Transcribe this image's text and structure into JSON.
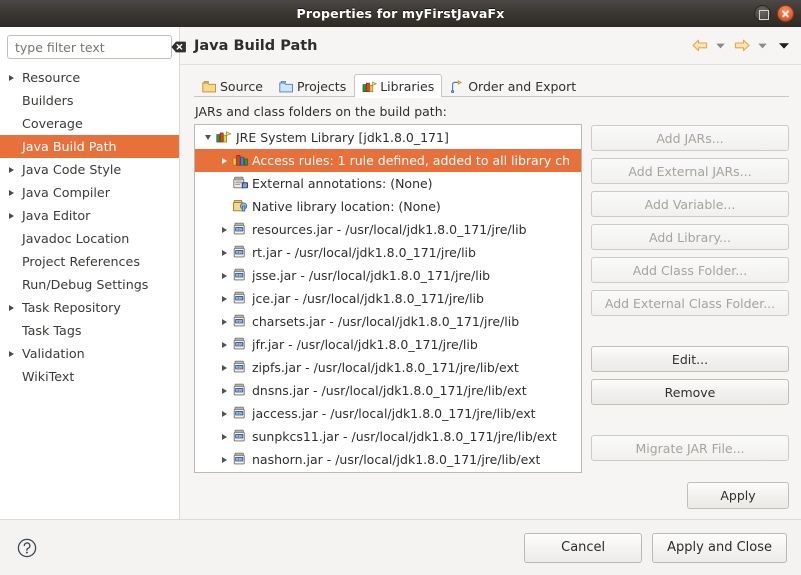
{
  "window": {
    "title": "Properties for myFirstJavaFx",
    "controls": [
      {
        "name": "maximize",
        "label": "Maximize"
      },
      {
        "name": "close",
        "label": "Close"
      }
    ]
  },
  "sidebar": {
    "filter": {
      "placeholder": "type filter text",
      "value": "",
      "clear_icon": "clear-backspace-icon"
    },
    "items": [
      {
        "label": "Resource",
        "expandable": true,
        "selected": false
      },
      {
        "label": "Builders",
        "expandable": false,
        "selected": false
      },
      {
        "label": "Coverage",
        "expandable": false,
        "selected": false
      },
      {
        "label": "Java Build Path",
        "expandable": false,
        "selected": true
      },
      {
        "label": "Java Code Style",
        "expandable": true,
        "selected": false
      },
      {
        "label": "Java Compiler",
        "expandable": true,
        "selected": false
      },
      {
        "label": "Java Editor",
        "expandable": true,
        "selected": false
      },
      {
        "label": "Javadoc Location",
        "expandable": false,
        "selected": false
      },
      {
        "label": "Project References",
        "expandable": false,
        "selected": false
      },
      {
        "label": "Run/Debug Settings",
        "expandable": false,
        "selected": false
      },
      {
        "label": "Task Repository",
        "expandable": true,
        "selected": false
      },
      {
        "label": "Task Tags",
        "expandable": false,
        "selected": false
      },
      {
        "label": "Validation",
        "expandable": true,
        "selected": false
      },
      {
        "label": "WikiText",
        "expandable": false,
        "selected": false
      }
    ]
  },
  "header": {
    "title": "Java Build Path",
    "nav": [
      {
        "name": "back-arrow-icon",
        "label": "Back"
      },
      {
        "name": "back-dropdown-icon",
        "label": "Back history"
      },
      {
        "name": "forward-arrow-icon",
        "label": "Forward"
      },
      {
        "name": "forward-dropdown-icon",
        "label": "Forward history"
      },
      {
        "name": "view-menu-icon",
        "label": "View menu"
      }
    ]
  },
  "tabs": [
    {
      "label": "Source",
      "icon": "source-folder-icon",
      "active": false
    },
    {
      "label": "Projects",
      "icon": "projects-folder-icon",
      "active": false
    },
    {
      "label": "Libraries",
      "icon": "libraries-icon",
      "active": true
    },
    {
      "label": "Order and Export",
      "icon": "order-export-icon",
      "active": false
    }
  ],
  "main": {
    "list_label": "JARs and class folders on the build path:",
    "tree": [
      {
        "label": "JRE System Library [jdk1.8.0_171]",
        "icon": "jre-library-icon",
        "indent": 0,
        "twisty": "open",
        "selected": false
      },
      {
        "label": "Access rules: 1 rule defined, added to all library ch",
        "icon": "access-rules-icon",
        "indent": 1,
        "twisty": "closed",
        "selected": true
      },
      {
        "label": "External annotations: (None)",
        "icon": "annotations-jar-icon",
        "indent": 1,
        "twisty": "none",
        "selected": false
      },
      {
        "label": "Native library location: (None)",
        "icon": "native-library-icon",
        "indent": 1,
        "twisty": "none",
        "selected": false
      },
      {
        "label": "resources.jar - /usr/local/jdk1.8.0_171/jre/lib",
        "icon": "jar-icon",
        "indent": 1,
        "twisty": "closed",
        "selected": false
      },
      {
        "label": "rt.jar - /usr/local/jdk1.8.0_171/jre/lib",
        "icon": "jar-icon",
        "indent": 1,
        "twisty": "closed",
        "selected": false
      },
      {
        "label": "jsse.jar - /usr/local/jdk1.8.0_171/jre/lib",
        "icon": "jar-icon",
        "indent": 1,
        "twisty": "closed",
        "selected": false
      },
      {
        "label": "jce.jar - /usr/local/jdk1.8.0_171/jre/lib",
        "icon": "jar-icon",
        "indent": 1,
        "twisty": "closed",
        "selected": false
      },
      {
        "label": "charsets.jar - /usr/local/jdk1.8.0_171/jre/lib",
        "icon": "jar-icon",
        "indent": 1,
        "twisty": "closed",
        "selected": false
      },
      {
        "label": "jfr.jar - /usr/local/jdk1.8.0_171/jre/lib",
        "icon": "jar-icon",
        "indent": 1,
        "twisty": "closed",
        "selected": false
      },
      {
        "label": "zipfs.jar - /usr/local/jdk1.8.0_171/jre/lib/ext",
        "icon": "jar-icon",
        "indent": 1,
        "twisty": "closed",
        "selected": false
      },
      {
        "label": "dnsns.jar - /usr/local/jdk1.8.0_171/jre/lib/ext",
        "icon": "jar-icon",
        "indent": 1,
        "twisty": "closed",
        "selected": false
      },
      {
        "label": "jaccess.jar - /usr/local/jdk1.8.0_171/jre/lib/ext",
        "icon": "jar-icon",
        "indent": 1,
        "twisty": "closed",
        "selected": false
      },
      {
        "label": "sunpkcs11.jar - /usr/local/jdk1.8.0_171/jre/lib/ext",
        "icon": "jar-icon",
        "indent": 1,
        "twisty": "closed",
        "selected": false
      },
      {
        "label": "nashorn.jar - /usr/local/jdk1.8.0_171/jre/lib/ext",
        "icon": "jar-icon",
        "indent": 1,
        "twisty": "closed",
        "selected": false
      }
    ],
    "buttons": [
      {
        "name": "add-jars-button",
        "label": "Add JARs...",
        "enabled": false,
        "gap": false
      },
      {
        "name": "add-external-jars-button",
        "label": "Add External JARs...",
        "enabled": false,
        "gap": false
      },
      {
        "name": "add-variable-button",
        "label": "Add Variable...",
        "enabled": false,
        "gap": false
      },
      {
        "name": "add-library-button",
        "label": "Add Library...",
        "enabled": false,
        "gap": false
      },
      {
        "name": "add-class-folder-button",
        "label": "Add Class Folder...",
        "enabled": false,
        "gap": false
      },
      {
        "name": "add-external-class-folder-button",
        "label": "Add External Class Folder...",
        "enabled": false,
        "gap": false
      },
      {
        "name": "edit-button",
        "label": "Edit...",
        "enabled": true,
        "gap": true
      },
      {
        "name": "remove-button",
        "label": "Remove",
        "enabled": true,
        "gap": false
      },
      {
        "name": "migrate-jar-file-button",
        "label": "Migrate JAR File...",
        "enabled": false,
        "gap": true
      }
    ],
    "apply_label": "Apply"
  },
  "footer": {
    "help_icon": "help-question-icon",
    "cancel_label": "Cancel",
    "apply_and_close_label": "Apply and Close"
  },
  "colors": {
    "selection": "#e8703b",
    "titlebar": "#39352f",
    "dialog_bg": "#f6f5f4",
    "list_bg": "#ffffff",
    "close_button": "#e2663a"
  }
}
